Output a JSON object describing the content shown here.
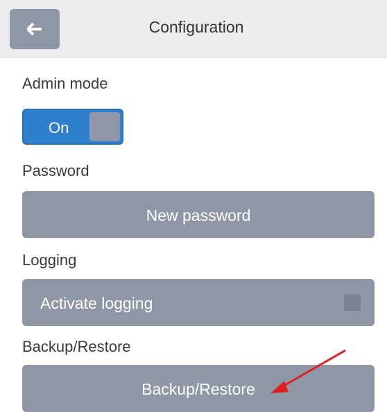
{
  "header": {
    "title": "Configuration",
    "back_icon": "arrow-left-icon"
  },
  "admin_mode": {
    "label": "Admin mode",
    "toggle_text": "On",
    "state": "on"
  },
  "password": {
    "label": "Password",
    "button": "New password"
  },
  "logging": {
    "label": "Logging",
    "button": "Activate logging",
    "checked": false
  },
  "backup": {
    "label": "Backup/Restore",
    "button": "Backup/Restore"
  },
  "colors": {
    "accent_blue": "#2f80cc",
    "button_gray": "#8f97a6",
    "header_bg": "#ececec",
    "annotation_red": "#e02020"
  }
}
